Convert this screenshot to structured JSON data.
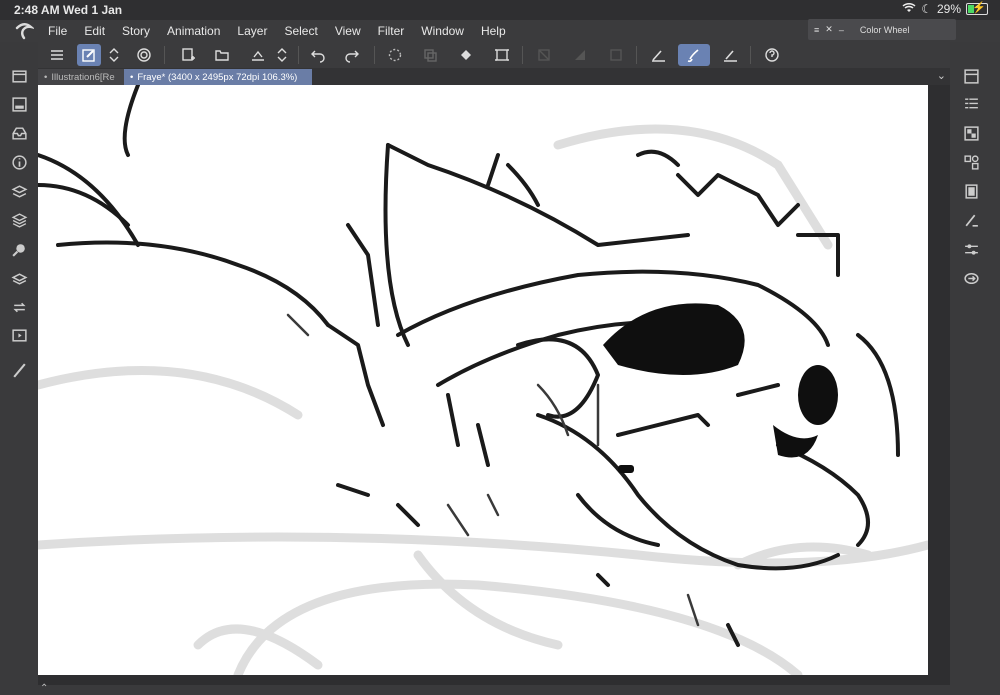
{
  "status": {
    "time": "2:48 AM",
    "date": "Wed 1 Jan",
    "battery": "29%"
  },
  "menu": [
    "File",
    "Edit",
    "Story",
    "Animation",
    "Layer",
    "Select",
    "View",
    "Filter",
    "Window",
    "Help"
  ],
  "color_wheel_panel": {
    "title": "Color Wheel"
  },
  "tabs": [
    {
      "label": "Illustration6[Re"
    },
    {
      "label": "Fraye* (3400 x 2495px 72dpi 106.3%)"
    }
  ],
  "icons": {
    "toolbar": [
      "menu-icon",
      "new-layer-icon",
      "stepper-icon",
      "spiral-icon",
      "new-canvas-icon",
      "open-folder-icon",
      "save-icon",
      "stepper-icon",
      "undo-icon",
      "redo-icon",
      "loading-icon",
      "copy-icon",
      "fill-icon",
      "transform-icon",
      "clear-selection-icon",
      "gradient-icon",
      "square-icon",
      "pen-icon",
      "brush-icon",
      "eraser-icon",
      "help-icon"
    ],
    "left": [
      "panel-icon",
      "layers-icon",
      "inbox-icon",
      "info-icon",
      "stack-icon",
      "stack2-icon",
      "search-icon",
      "layers2-icon",
      "sync-icon",
      "film-icon",
      "pen-tool-icon"
    ],
    "right": [
      "panel-right-icon",
      "list-icon",
      "grid-icon",
      "shapes-icon",
      "copy2-icon",
      "brush-settings-icon",
      "sliders-icon",
      "export-icon"
    ]
  },
  "accent_color": "#6a82b3"
}
